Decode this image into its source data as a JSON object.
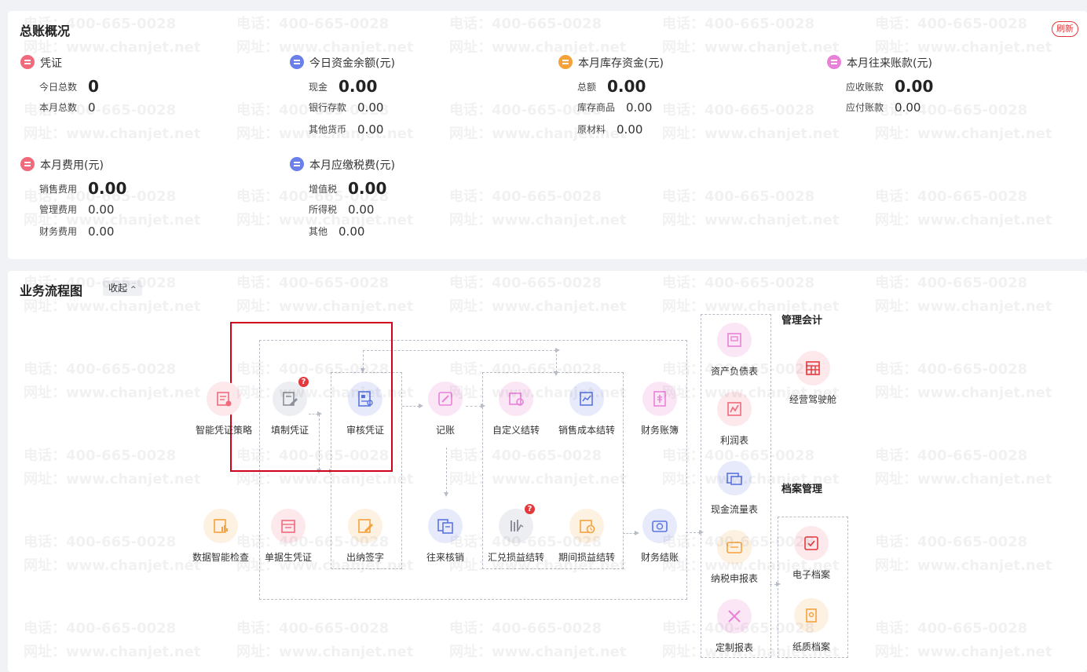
{
  "ledger": {
    "title": "总账概况",
    "refresh_label": "刷新",
    "blocks": [
      {
        "title": "凭证",
        "color": "#f06a7c",
        "rows": [
          {
            "label": "今日总数",
            "value": "0"
          },
          {
            "label": "本月总数",
            "value": "0"
          }
        ]
      },
      {
        "title": "今日资金余额(元)",
        "color": "#6b7fe8",
        "rows": [
          {
            "label": "现金",
            "value": "0.00"
          },
          {
            "label": "银行存款",
            "value": "0.00"
          },
          {
            "label": "其他货币",
            "value": "0.00"
          }
        ]
      },
      {
        "title": "本月库存资金(元)",
        "color": "#f5a23c",
        "rows": [
          {
            "label": "总额",
            "value": "0.00"
          },
          {
            "label": "库存商品",
            "value": "0.00"
          },
          {
            "label": "原材料",
            "value": "0.00"
          }
        ]
      },
      {
        "title": "本月往来账款(元)",
        "color": "#e882d8",
        "rows": [
          {
            "label": "应收账款",
            "value": "0.00"
          },
          {
            "label": "应付账款",
            "value": "0.00"
          }
        ]
      },
      {
        "title": "本月费用(元)",
        "color": "#f06a7c",
        "rows": [
          {
            "label": "销售费用",
            "value": "0.00"
          },
          {
            "label": "管理费用",
            "value": "0.00"
          },
          {
            "label": "财务费用",
            "value": "0.00"
          }
        ]
      },
      {
        "title": "本月应缴税费(元)",
        "color": "#6b7fe8",
        "rows": [
          {
            "label": "增值税",
            "value": "0.00"
          },
          {
            "label": "所得税",
            "value": "0.00"
          },
          {
            "label": "其他",
            "value": "0.00"
          }
        ]
      }
    ]
  },
  "flow": {
    "title": "业务流程图",
    "collapse_label": "收起",
    "collapse_icon": "chevron-up-icon",
    "mgmt_title": "管理会计",
    "archive_title": "档案管理",
    "badge_text": "?",
    "nodes": {
      "smart_strategy": {
        "label": "智能凭证策略",
        "icon": "smart-voucher-icon",
        "color": "#f06a7c"
      },
      "fill_voucher": {
        "label": "填制凭证",
        "icon": "edit-voucher-icon",
        "color": "#8a8f99"
      },
      "audit_voucher": {
        "label": "审核凭证",
        "icon": "audit-voucher-icon",
        "color": "#5b74e0"
      },
      "post": {
        "label": "记账",
        "icon": "post-ledger-icon",
        "color": "#e882d8"
      },
      "custom_transfer": {
        "label": "自定义结转",
        "icon": "custom-transfer-icon",
        "color": "#e882d8"
      },
      "sales_cost": {
        "label": "销售成本结转",
        "icon": "sales-cost-icon",
        "color": "#5b74e0"
      },
      "fin_books": {
        "label": "财务账簿",
        "icon": "books-icon",
        "color": "#e882d8"
      },
      "data_check": {
        "label": "数据智能检查",
        "icon": "data-check-icon",
        "color": "#f5a23c"
      },
      "doc_voucher": {
        "label": "单据生凭证",
        "icon": "doc-voucher-icon",
        "color": "#f06a7c"
      },
      "cashier_sign": {
        "label": "出纳签字",
        "icon": "sign-icon",
        "color": "#f5a23c"
      },
      "reconcile": {
        "label": "往来核销",
        "icon": "reconcile-icon",
        "color": "#5b74e0"
      },
      "fx_transfer": {
        "label": "汇兑损益结转",
        "icon": "fx-icon",
        "color": "#8a8f99"
      },
      "pl_transfer": {
        "label": "期间损益结转",
        "icon": "period-icon",
        "color": "#f5a23c"
      },
      "close": {
        "label": "财务结账",
        "icon": "close-books-icon",
        "color": "#5b74e0"
      },
      "balance_sheet": {
        "label": "资产负债表",
        "icon": "balance-sheet-icon",
        "color": "#e882d8"
      },
      "income": {
        "label": "利润表",
        "icon": "income-icon",
        "color": "#f06a7c"
      },
      "cashflow": {
        "label": "现金流量表",
        "icon": "cashflow-icon",
        "color": "#5b74e0"
      },
      "tax": {
        "label": "纳税申报表",
        "icon": "tax-icon",
        "color": "#f5a23c"
      },
      "custom_report": {
        "label": "定制报表",
        "icon": "custom-report-icon",
        "color": "#e882d8"
      },
      "cockpit": {
        "label": "经营驾驶舱",
        "icon": "cockpit-icon",
        "color": "#e4393c"
      },
      "e_archive": {
        "label": "电子档案",
        "icon": "e-archive-icon",
        "color": "#e4393c"
      },
      "paper_archive": {
        "label": "纸质档案",
        "icon": "paper-archive-icon",
        "color": "#f5a23c"
      }
    }
  },
  "watermark": {
    "phone": "电话：400-665-0028",
    "site": "网址：www.chanjet.net"
  }
}
